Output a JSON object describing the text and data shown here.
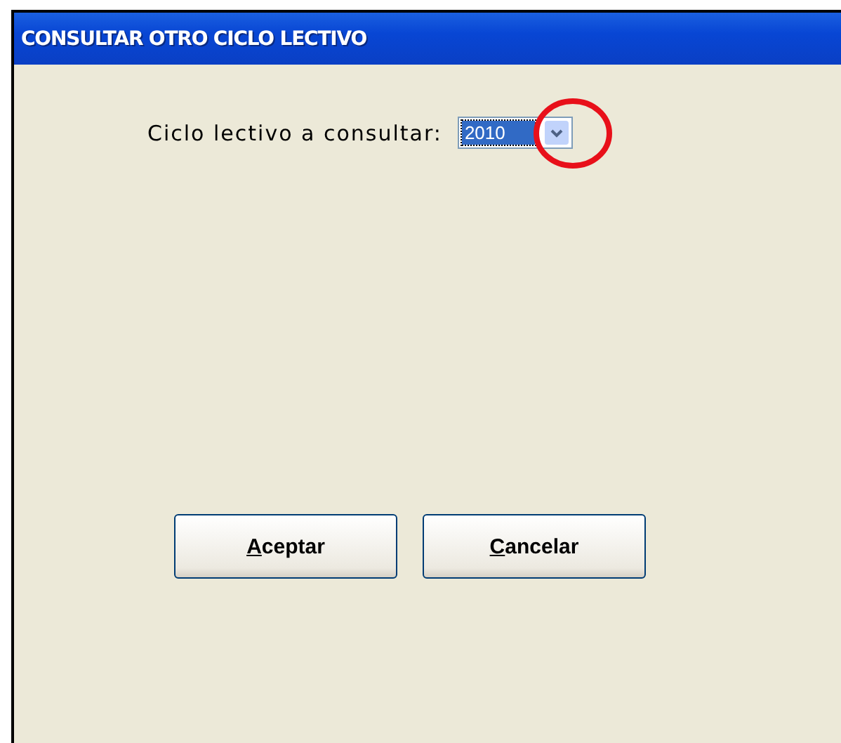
{
  "window": {
    "title": "CONSULTAR OTRO CICLO LECTIVO"
  },
  "field": {
    "label": "Ciclo lectivo a consultar:",
    "value": "2010",
    "selected": true,
    "highlighted": true
  },
  "buttons": [
    {
      "label": "Aceptar",
      "mnemonic": true
    },
    {
      "label": "Cancelar",
      "mnemonic": true
    }
  ]
}
